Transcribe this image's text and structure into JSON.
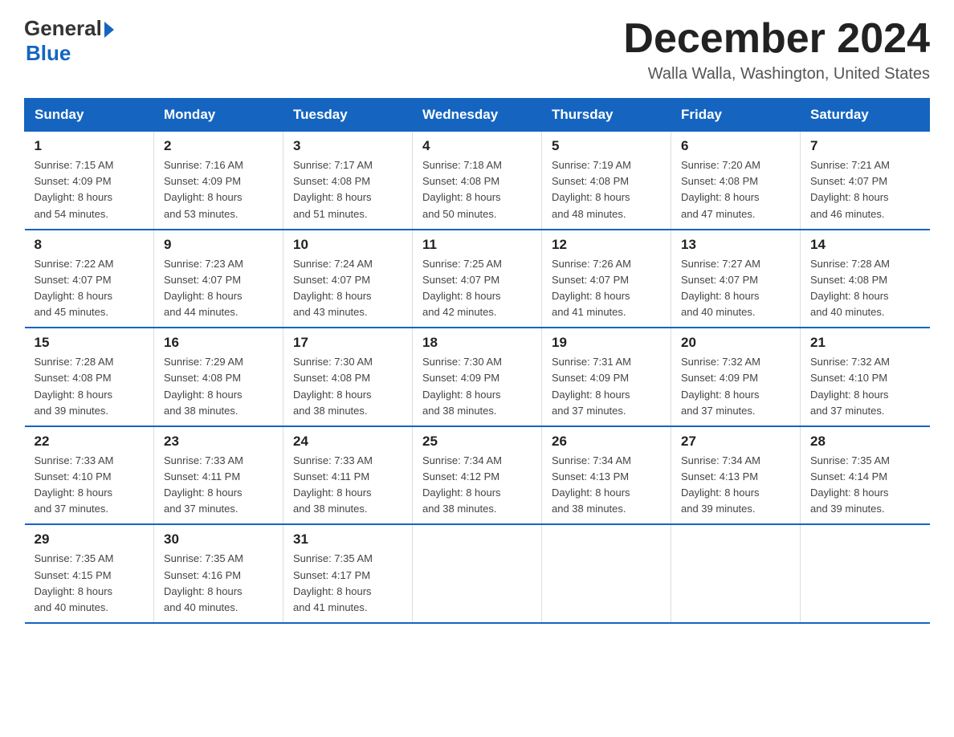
{
  "header": {
    "logo": {
      "general": "General",
      "blue": "Blue",
      "arrow": "▶"
    },
    "title": "December 2024",
    "location": "Walla Walla, Washington, United States"
  },
  "weekdays": [
    "Sunday",
    "Monday",
    "Tuesday",
    "Wednesday",
    "Thursday",
    "Friday",
    "Saturday"
  ],
  "weeks": [
    [
      {
        "day": "1",
        "sunrise": "7:15 AM",
        "sunset": "4:09 PM",
        "daylight": "8 hours and 54 minutes."
      },
      {
        "day": "2",
        "sunrise": "7:16 AM",
        "sunset": "4:09 PM",
        "daylight": "8 hours and 53 minutes."
      },
      {
        "day": "3",
        "sunrise": "7:17 AM",
        "sunset": "4:08 PM",
        "daylight": "8 hours and 51 minutes."
      },
      {
        "day": "4",
        "sunrise": "7:18 AM",
        "sunset": "4:08 PM",
        "daylight": "8 hours and 50 minutes."
      },
      {
        "day": "5",
        "sunrise": "7:19 AM",
        "sunset": "4:08 PM",
        "daylight": "8 hours and 48 minutes."
      },
      {
        "day": "6",
        "sunrise": "7:20 AM",
        "sunset": "4:08 PM",
        "daylight": "8 hours and 47 minutes."
      },
      {
        "day": "7",
        "sunrise": "7:21 AM",
        "sunset": "4:07 PM",
        "daylight": "8 hours and 46 minutes."
      }
    ],
    [
      {
        "day": "8",
        "sunrise": "7:22 AM",
        "sunset": "4:07 PM",
        "daylight": "8 hours and 45 minutes."
      },
      {
        "day": "9",
        "sunrise": "7:23 AM",
        "sunset": "4:07 PM",
        "daylight": "8 hours and 44 minutes."
      },
      {
        "day": "10",
        "sunrise": "7:24 AM",
        "sunset": "4:07 PM",
        "daylight": "8 hours and 43 minutes."
      },
      {
        "day": "11",
        "sunrise": "7:25 AM",
        "sunset": "4:07 PM",
        "daylight": "8 hours and 42 minutes."
      },
      {
        "day": "12",
        "sunrise": "7:26 AM",
        "sunset": "4:07 PM",
        "daylight": "8 hours and 41 minutes."
      },
      {
        "day": "13",
        "sunrise": "7:27 AM",
        "sunset": "4:07 PM",
        "daylight": "8 hours and 40 minutes."
      },
      {
        "day": "14",
        "sunrise": "7:28 AM",
        "sunset": "4:08 PM",
        "daylight": "8 hours and 40 minutes."
      }
    ],
    [
      {
        "day": "15",
        "sunrise": "7:28 AM",
        "sunset": "4:08 PM",
        "daylight": "8 hours and 39 minutes."
      },
      {
        "day": "16",
        "sunrise": "7:29 AM",
        "sunset": "4:08 PM",
        "daylight": "8 hours and 38 minutes."
      },
      {
        "day": "17",
        "sunrise": "7:30 AM",
        "sunset": "4:08 PM",
        "daylight": "8 hours and 38 minutes."
      },
      {
        "day": "18",
        "sunrise": "7:30 AM",
        "sunset": "4:09 PM",
        "daylight": "8 hours and 38 minutes."
      },
      {
        "day": "19",
        "sunrise": "7:31 AM",
        "sunset": "4:09 PM",
        "daylight": "8 hours and 37 minutes."
      },
      {
        "day": "20",
        "sunrise": "7:32 AM",
        "sunset": "4:09 PM",
        "daylight": "8 hours and 37 minutes."
      },
      {
        "day": "21",
        "sunrise": "7:32 AM",
        "sunset": "4:10 PM",
        "daylight": "8 hours and 37 minutes."
      }
    ],
    [
      {
        "day": "22",
        "sunrise": "7:33 AM",
        "sunset": "4:10 PM",
        "daylight": "8 hours and 37 minutes."
      },
      {
        "day": "23",
        "sunrise": "7:33 AM",
        "sunset": "4:11 PM",
        "daylight": "8 hours and 37 minutes."
      },
      {
        "day": "24",
        "sunrise": "7:33 AM",
        "sunset": "4:11 PM",
        "daylight": "8 hours and 38 minutes."
      },
      {
        "day": "25",
        "sunrise": "7:34 AM",
        "sunset": "4:12 PM",
        "daylight": "8 hours and 38 minutes."
      },
      {
        "day": "26",
        "sunrise": "7:34 AM",
        "sunset": "4:13 PM",
        "daylight": "8 hours and 38 minutes."
      },
      {
        "day": "27",
        "sunrise": "7:34 AM",
        "sunset": "4:13 PM",
        "daylight": "8 hours and 39 minutes."
      },
      {
        "day": "28",
        "sunrise": "7:35 AM",
        "sunset": "4:14 PM",
        "daylight": "8 hours and 39 minutes."
      }
    ],
    [
      {
        "day": "29",
        "sunrise": "7:35 AM",
        "sunset": "4:15 PM",
        "daylight": "8 hours and 40 minutes."
      },
      {
        "day": "30",
        "sunrise": "7:35 AM",
        "sunset": "4:16 PM",
        "daylight": "8 hours and 40 minutes."
      },
      {
        "day": "31",
        "sunrise": "7:35 AM",
        "sunset": "4:17 PM",
        "daylight": "8 hours and 41 minutes."
      },
      null,
      null,
      null,
      null
    ]
  ],
  "labels": {
    "sunrise_prefix": "Sunrise: ",
    "sunset_prefix": "Sunset: ",
    "daylight_prefix": "Daylight: "
  }
}
